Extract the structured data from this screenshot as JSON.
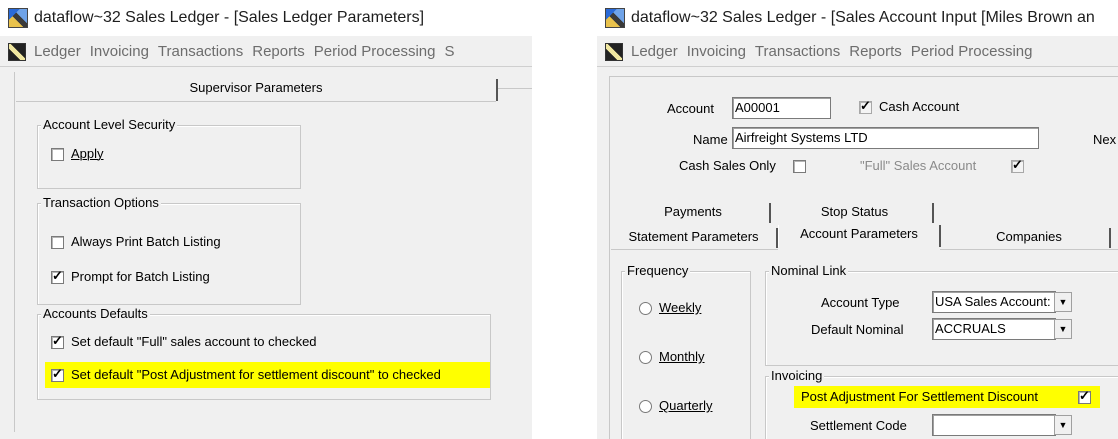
{
  "left": {
    "title": "dataflow~32 Sales Ledger - [Sales Ledger Parameters]",
    "menu": [
      "Ledger",
      "Invoicing",
      "Transactions",
      "Reports",
      "Period Processing",
      "S"
    ],
    "tab_label": "Supervisor Parameters",
    "account_level_security": {
      "title": "Account Level Security",
      "apply_label": "Apply",
      "apply_checked": false
    },
    "transaction_options": {
      "title": "Transaction Options",
      "always_print_label": "Always Print Batch Listing",
      "always_print_checked": false,
      "prompt_label": "Prompt for Batch Listing",
      "prompt_checked": true
    },
    "accounts_defaults": {
      "title": "Accounts Defaults",
      "full_sales_label": "Set default \"Full\" sales account to checked",
      "full_sales_checked": true,
      "post_adjustment_label": "Set default \"Post Adjustment for settlement discount\" to checked",
      "post_adjustment_checked": true
    }
  },
  "right": {
    "title": "dataflow~32 Sales Ledger - [Sales Account Input [Miles Brown an",
    "menu": [
      "Ledger",
      "Invoicing",
      "Transactions",
      "Reports",
      "Period Processing"
    ],
    "account_label": "Account",
    "account_value": "A00001",
    "cash_account_label": "Cash Account",
    "cash_account_checked": true,
    "name_label": "Name",
    "name_value": "Airfreight Systems LTD",
    "next_label": "Nex",
    "cash_sales_only_label": "Cash Sales Only",
    "cash_sales_only_checked": false,
    "full_sales_label": "\"Full\" Sales Account",
    "full_sales_checked": true,
    "tabs_row1": [
      "Payments",
      "Stop Status"
    ],
    "tabs_row2": [
      "Statement Parameters",
      "Account Parameters",
      "Companies"
    ],
    "frequency": {
      "title": "Frequency",
      "options": [
        "Weekly",
        "Monthly",
        "Quarterly"
      ]
    },
    "nominal_link": {
      "title": "Nominal Link",
      "account_type_label": "Account Type",
      "account_type_value": "USA Sales Account:",
      "default_nominal_label": "Default Nominal",
      "default_nominal_value": "ACCRUALS"
    },
    "invoicing": {
      "title": "Invoicing",
      "post_adjustment_label": "Post Adjustment For Settlement Discount",
      "post_adjustment_checked": true,
      "settlement_code_label": "Settlement Code",
      "settlement_code_value": ""
    }
  },
  "icons": {
    "check": "✓",
    "dropdown": "▼"
  },
  "colors": {
    "highlight": "#ffff00",
    "window_bg": "#f0f0f0"
  }
}
